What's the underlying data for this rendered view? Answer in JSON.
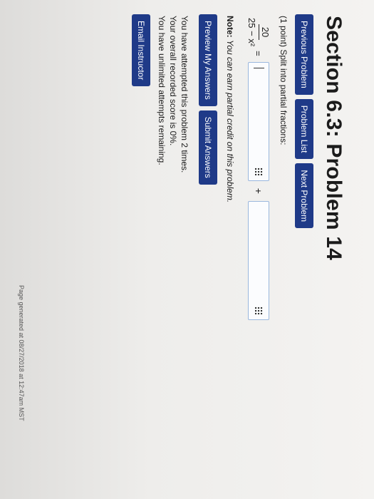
{
  "section_title": "Section 6.3: Problem 14",
  "nav": {
    "previous": "Previous Problem",
    "list": "Problem List",
    "next": "Next Problem"
  },
  "problem": {
    "prompt": "(1 point) Split into partial fractions:",
    "numerator": "20",
    "denominator": "25 − x²",
    "equals": "=",
    "plus": "+"
  },
  "note": {
    "label": "Note:",
    "text": "You can earn partial credit on this problem."
  },
  "actions": {
    "preview": "Preview My Answers",
    "submit": "Submit Answers"
  },
  "status": {
    "attempts": "You have attempted this problem 2 times.",
    "score": "Your overall recorded score is 0%.",
    "remaining": "You have unlimited attempts remaining."
  },
  "email_instructor": "Email Instructor",
  "footer": "Page generated at 08/27/2018 at 12:47am MST",
  "colors": {
    "button_bg": "#1f3a88",
    "input_border": "#9ab7dd"
  },
  "icons": {
    "answer_helper": "grid-dots-icon"
  }
}
